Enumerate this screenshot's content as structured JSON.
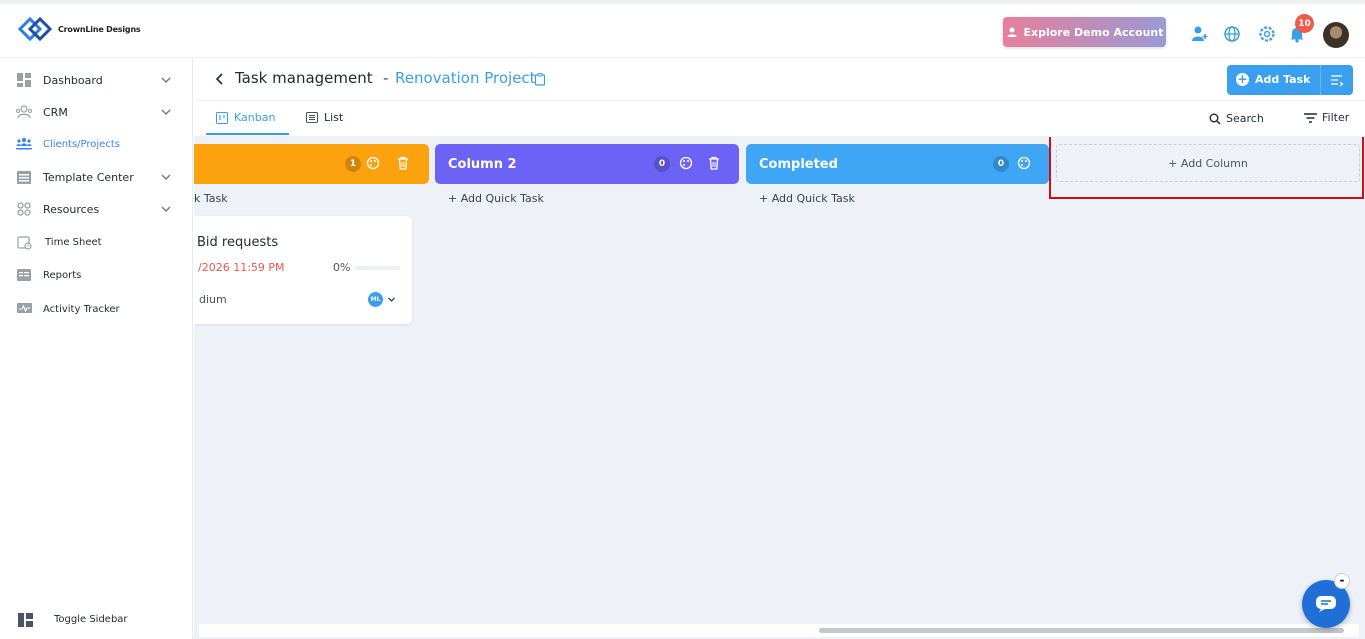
{
  "brand": {
    "name": "CrownLine Designs"
  },
  "topbar": {
    "demo_button": "Explore Demo Account",
    "notification_count": "10",
    "icons": [
      "add-user-icon",
      "globe-icon",
      "settings-icon",
      "bell-icon"
    ]
  },
  "sidebar": {
    "items": [
      {
        "label": "Dashboard",
        "icon": "dashboard-icon",
        "has_chevron": true
      },
      {
        "label": "CRM",
        "icon": "crm-icon",
        "has_chevron": true
      },
      {
        "label": "Clients/Projects",
        "icon": "clients-icon",
        "has_chevron": false,
        "active": true
      },
      {
        "label": "Template Center",
        "icon": "template-icon",
        "has_chevron": true
      },
      {
        "label": "Resources",
        "icon": "resources-icon",
        "has_chevron": true
      },
      {
        "label": "Time Sheet",
        "icon": "timesheet-icon",
        "has_chevron": false
      },
      {
        "label": "Reports",
        "icon": "reports-icon",
        "has_chevron": false
      },
      {
        "label": "Activity Tracker",
        "icon": "activity-icon",
        "has_chevron": false
      }
    ],
    "toggle_label": "Toggle Sidebar"
  },
  "header": {
    "title": "Task management",
    "separator": "-",
    "project": "Renovation Project",
    "add_task_label": "Add Task"
  },
  "tabs": {
    "kanban": "Kanban",
    "list": "List",
    "search": "Search",
    "filter": "Filter"
  },
  "board": {
    "columns": [
      {
        "title": "",
        "count": "1",
        "color": "#fda20f",
        "quick_add": "k Task"
      },
      {
        "title": "Column 2",
        "count": "0",
        "color": "#6c63f6",
        "quick_add": "+ Add Quick Task"
      },
      {
        "title": "Completed",
        "count": "0",
        "color": "#3ea6f4",
        "quick_add": "+ Add Quick Task"
      }
    ],
    "add_column_label": "+ Add Column",
    "task": {
      "title": "Bid requests",
      "due": "/2026 11:59 PM",
      "progress_label": "0%",
      "progress": 0,
      "priority": "dium",
      "assignee_initials": "ML"
    }
  },
  "colors": {
    "accent": "#3b9fe6",
    "highlight": "#d10e15",
    "due_date": "#e8574f"
  }
}
